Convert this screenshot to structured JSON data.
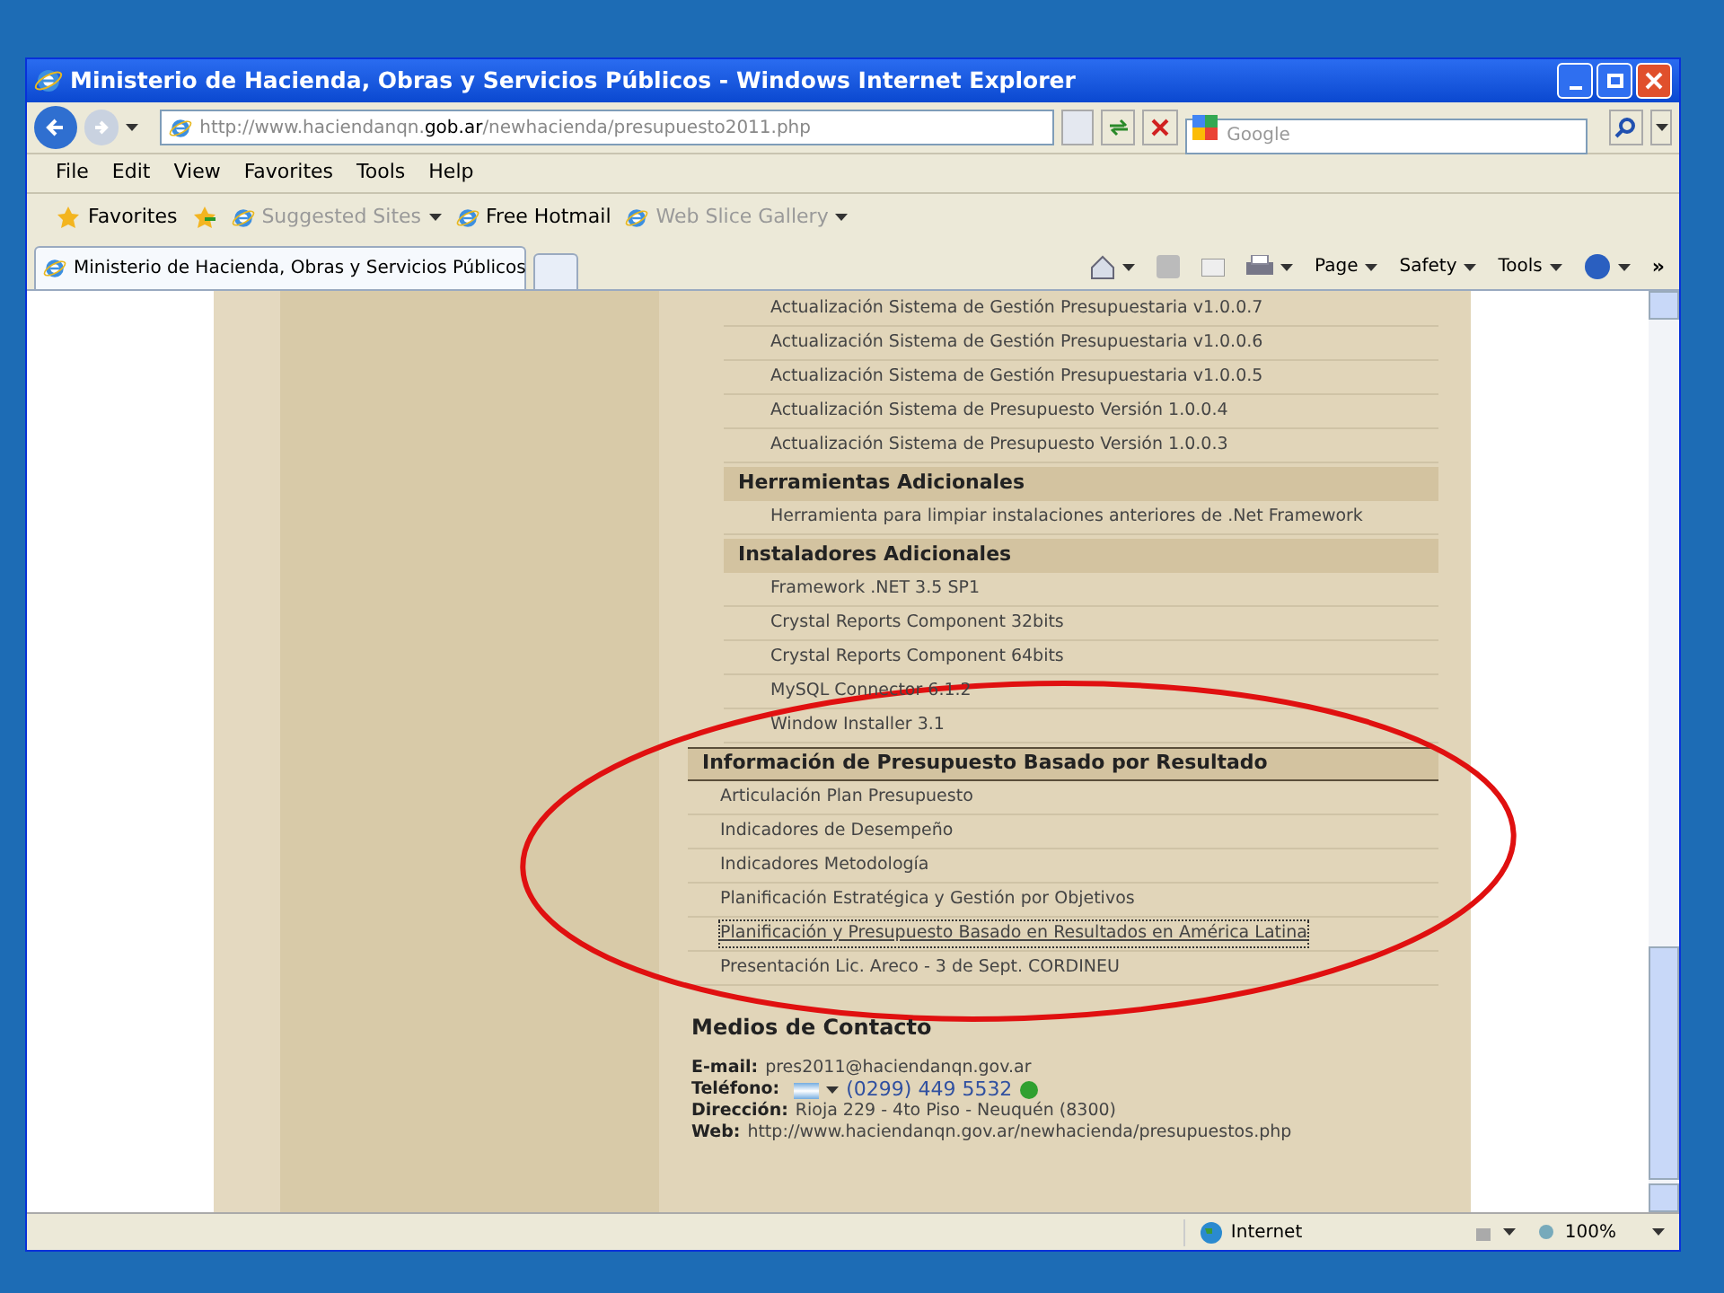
{
  "window": {
    "title": "Ministerio de Hacienda, Obras y Servicios Públicos - Windows Internet Explorer"
  },
  "address": {
    "prefix": "http://www.haciendanqn.",
    "domain": "gob.ar",
    "suffix": "/newhacienda/presupuesto2011.php"
  },
  "search": {
    "placeholder": "Google"
  },
  "menu": [
    "File",
    "Edit",
    "View",
    "Favorites",
    "Tools",
    "Help"
  ],
  "favorites_bar": [
    {
      "label": "Favorites",
      "kind": "favorites",
      "enabled": true
    },
    {
      "label": "Suggested Sites",
      "kind": "dropdown",
      "enabled": false
    },
    {
      "label": "Free Hotmail",
      "kind": "link",
      "enabled": true
    },
    {
      "label": "Web Slice Gallery",
      "kind": "dropdown",
      "enabled": false
    }
  ],
  "tab": {
    "title": "Ministerio de Hacienda, Obras y Servicios Públicos"
  },
  "command_bar": [
    "Page",
    "Safety",
    "Tools"
  ],
  "command_bar_overflow": "»",
  "sections": [
    {
      "kind": "subsection",
      "items": [
        {
          "label": "Actualización Sistema de Gestión Presupuestaria v1.0.0.7",
          "focused": false
        },
        {
          "label": "Actualización Sistema de Gestión Presupuestaria v1.0.0.6",
          "focused": false
        },
        {
          "label": "Actualización Sistema de Gestión Presupuestaria v1.0.0.5",
          "focused": false
        },
        {
          "label": "Actualización Sistema de Presupuesto Versión 1.0.0.4",
          "focused": false
        },
        {
          "label": "Actualización Sistema de Presupuesto Versión 1.0.0.3",
          "focused": false
        }
      ]
    },
    {
      "kind": "subsection",
      "heading": "Herramientas Adicionales",
      "items": [
        {
          "label": "Herramienta para limpiar instalaciones anteriores de .Net Framework",
          "focused": false
        }
      ]
    },
    {
      "kind": "subsection",
      "heading": "Instaladores Adicionales",
      "items": [
        {
          "label": "Framework .NET 3.5 SP1",
          "focused": false
        },
        {
          "label": "Crystal Reports Component 32bits",
          "focused": false
        },
        {
          "label": "Crystal Reports Component 64bits",
          "focused": false
        },
        {
          "label": "MySQL Connector 6.1.2",
          "focused": false
        },
        {
          "label": "Window Installer 3.1",
          "focused": false
        }
      ]
    },
    {
      "kind": "section",
      "heading": "Información de Presupuesto Basado por Resultado",
      "items": [
        {
          "label": "Articulación Plan Presupuesto",
          "focused": false
        },
        {
          "label": "Indicadores de Desempeño",
          "focused": false
        },
        {
          "label": "Indicadores Metodología",
          "focused": false
        },
        {
          "label": "Planificación Estratégica y Gestión por Objetivos",
          "focused": false
        },
        {
          "label": "Planificación y Presupuesto Basado en Resultados en América Latina",
          "focused": true
        },
        {
          "label": "Presentación Lic. Areco - 3 de Sept. CORDINEU",
          "focused": false
        }
      ]
    }
  ],
  "contact": {
    "heading": "Medios de Contacto",
    "lines": [
      {
        "kind": "text",
        "label": "E-mail:",
        "value": "pres2011@haciendanqn.gov.ar"
      },
      {
        "kind": "phone",
        "label": "Teléfono:",
        "value": "(0299) 449 5532"
      },
      {
        "kind": "text",
        "label": "Dirección:",
        "value": "Rioja 229 - 4to Piso - Neuquén (8300)"
      },
      {
        "kind": "text",
        "label": "Web:",
        "value": "http://www.haciendanqn.gov.ar/newhacienda/presupuestos.php"
      }
    ]
  },
  "status_bar": {
    "zone": "Internet",
    "zoom": "100%"
  }
}
